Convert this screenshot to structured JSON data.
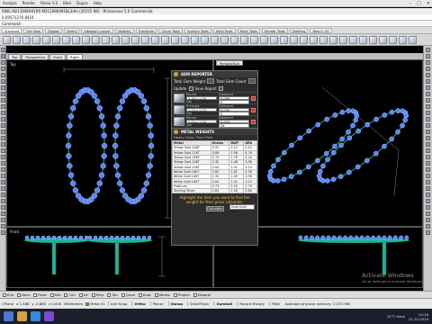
{
  "menubar": {
    "items": [
      "Analyze",
      "Render",
      "Rhino 5.0",
      "Bled",
      "Dupco",
      "Help"
    ],
    "window_controls": [
      "–",
      "□",
      "✕"
    ]
  },
  "titlebar": {
    "text": "RING M21169E991RR M21169E991BL3dm (20155 KB) - Rhinoceros 5.0 Commercial"
  },
  "command": {
    "history": "0.69571270 8424",
    "prompt": "Command:",
    "value": ""
  },
  "toolbar_tabs": [
    "Standard",
    "Set View",
    "Display",
    "Select",
    "Viewport Layout",
    "Visibility",
    "Transform",
    "Curve Tools",
    "Surface Tools",
    "Solid Tools",
    "Mesh Tools",
    "Render Tools",
    "Drafting",
    "New in V5"
  ],
  "viewport_tabs": [
    "Top",
    "Perspective",
    "Front",
    "Right"
  ],
  "viewports": {
    "top": "Top",
    "perspective": "Perspective",
    "front": "Front",
    "right": "Right"
  },
  "gem_panel": {
    "title": "GEM REPORTER",
    "total_weight_label": "Total Gem Weight",
    "total_count_label": "Total Gem Count",
    "update_label": "Update",
    "save_report_label": "Save Report",
    "gems": [
      {
        "shape": "Round",
        "size": "1.30 x 1.30",
        "count_label": "Qty",
        "count": "0",
        "dia_label": "Diamond",
        "ct": "0.009"
      },
      {
        "shape": "Princess",
        "size": "1.70 x 1.70",
        "count_label": "Qty",
        "count": "0",
        "dia_label": "Diamond",
        "ct": "0.000"
      },
      {
        "shape": "Round",
        "size": "1.00 x 1.00",
        "count_label": "Qty",
        "count": "36",
        "dia_label": "Diamond",
        "ct": "0.004"
      }
    ]
  },
  "metal_panel": {
    "title": "METAL WEIGHTS",
    "subtitle": "Heavy Casts / Post Plate",
    "columns": [
      "Metal",
      "Grams",
      "DWT",
      "GRS"
    ],
    "rows": [
      [
        "Yellow Gold 24KT",
        "3.32",
        "2.13",
        "5.14"
      ],
      [
        "Yellow Gold 22KT",
        "3.08",
        "1.98",
        "4.76"
      ],
      [
        "Yellow Gold 18KT",
        "2.74",
        "1.76",
        "4.24"
      ],
      [
        "Yellow Gold 14KT",
        "2.30",
        "1.48",
        "3.56"
      ],
      [
        "Yellow Gold 10KT",
        "2.04",
        "1.31",
        "3.15"
      ],
      [
        "White Gold 18KT",
        "2.82",
        "1.81",
        "4.36"
      ],
      [
        "White Gold 14KT",
        "2.32",
        "1.49",
        "3.58"
      ],
      [
        "White Gold 10KT",
        "2.04",
        "1.31",
        "3.15"
      ],
      [
        "Platinum",
        "3.73",
        "2.40",
        "5.76"
      ],
      [
        "Sterling Silver",
        "1.81",
        "1.16",
        "2.80"
      ]
    ],
    "note": "Highlight the item you want to find the weight for then press calculate.",
    "metal_select": "Gold Gold 18KT",
    "calculate_label": "Calculate"
  },
  "osnap": [
    "End",
    "Near",
    "Point",
    "Mid",
    "Cen",
    "Int",
    "Perp",
    "Tan",
    "Quad",
    "Knot",
    "Vertex",
    "Project",
    "Disable"
  ],
  "status": {
    "cplane": "CPlane",
    "x": "x 1.588",
    "y": "y -0.880",
    "z": "z 0.000",
    "units": "Millimeters",
    "layer": "Metal 01",
    "buttons": [
      "Grid Snap",
      "Ortho",
      "Planar",
      "Osnap",
      "SmartTrack",
      "Gumball",
      "Record History",
      "Filter"
    ],
    "memory": "Available physical memory: 11572 MB"
  },
  "tray": {
    "temp": "31°C Haze",
    "time": "10:26",
    "date": "21-10-2019"
  },
  "activate": {
    "title": "Activate Windows",
    "sub": "Go to Settings to activate Windows."
  },
  "colors": {
    "ring_metal": "#21b39a",
    "gem": "#5d82ff",
    "gem_highlight": "#aee6ff",
    "dimension": "#9a9a9a",
    "panel": "#2d2d2d"
  }
}
